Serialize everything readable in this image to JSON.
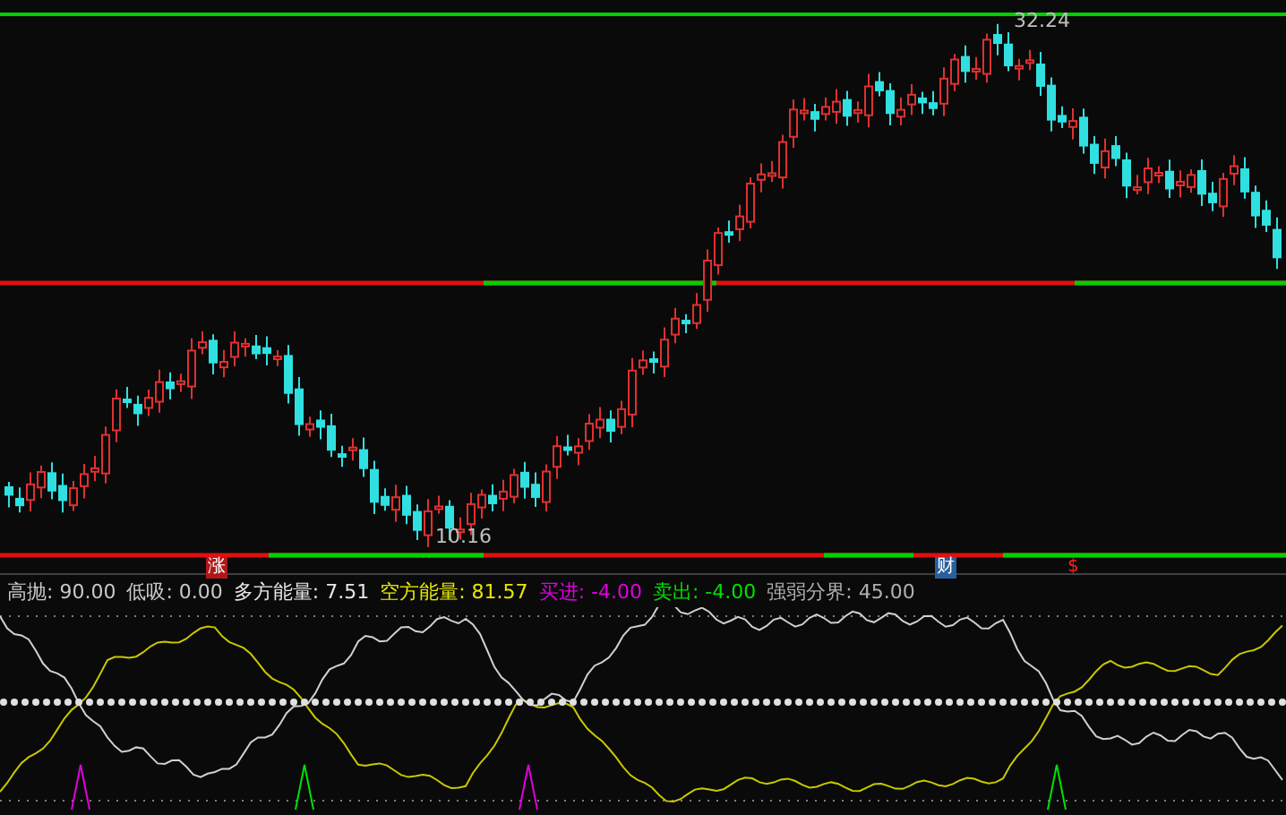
{
  "price_chart": {
    "high_label": "32.24",
    "low_label": "10.16",
    "markers": [
      {
        "text": "涨",
        "kind": "badge",
        "color": "#b01818"
      },
      {
        "text": "财",
        "kind": "badge",
        "color": "#2a5f9e"
      },
      {
        "text": "$",
        "kind": "plain",
        "color": "#ff2020"
      }
    ]
  },
  "indicator_legend": [
    {
      "text": "高抛: 90.00",
      "color": "#c8c8c8"
    },
    {
      "text": "低吸: 0.00",
      "color": "#c8c8c8"
    },
    {
      "text": "多方能量: 7.51",
      "color": "#e8e8e8"
    },
    {
      "text": "空方能量: 81.57",
      "color": "#e8e800"
    },
    {
      "text": "买进: -4.00",
      "color": "#e000e0"
    },
    {
      "text": "卖出: -4.00",
      "color": "#00e000"
    },
    {
      "text": "强弱分界: 45.00",
      "color": "#b0b0b0"
    }
  ]
}
